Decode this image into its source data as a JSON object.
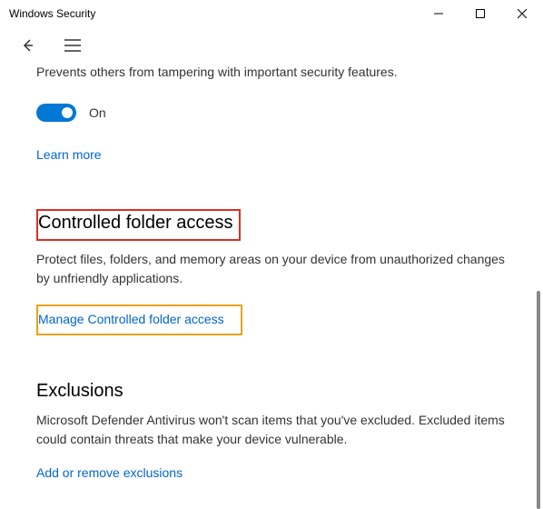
{
  "window": {
    "title": "Windows Security"
  },
  "tamper": {
    "desc": "Prevents others from tampering with important security features.",
    "toggle_state": "On",
    "learn_more": "Learn more"
  },
  "controlled_folder": {
    "title": "Controlled folder access",
    "desc": "Protect files, folders, and memory areas on your device from unauthorized changes by unfriendly applications.",
    "link": "Manage Controlled folder access"
  },
  "exclusions": {
    "title": "Exclusions",
    "desc": "Microsoft Defender Antivirus won't scan items that you've excluded. Excluded items could contain threats that make your device vulnerable.",
    "link": "Add or remove exclusions"
  }
}
